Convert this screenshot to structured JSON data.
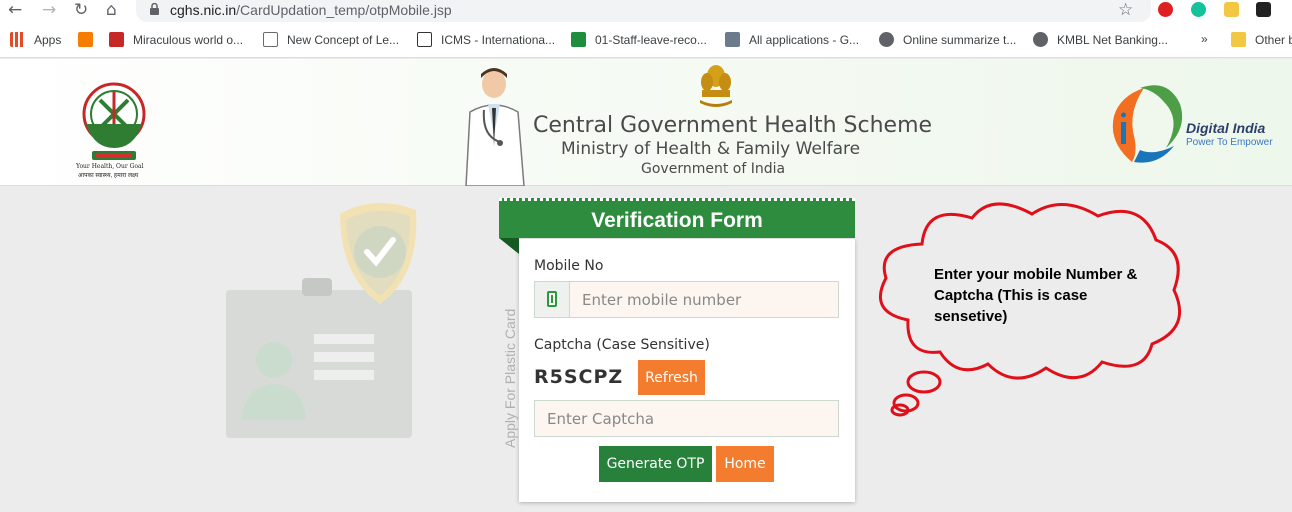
{
  "browser": {
    "url_host": "cghs.nic.in",
    "url_path": "/CardUpdation_temp/otpMobile.jsp",
    "bookmarks": [
      {
        "label": "Apps",
        "icon": "apps-grid-icon",
        "color": "#e34c26"
      },
      {
        "label": "",
        "icon": "blogger-icon",
        "color": "#f57d00"
      },
      {
        "label": "Miraculous world o...",
        "icon": "m-logo-icon",
        "color": "#c62828"
      },
      {
        "label": "New Concept of Le...",
        "icon": "page-icon",
        "color": "#6b6b6b"
      },
      {
        "label": "ICMS - Internationa...",
        "icon": "icms-icon",
        "color": "#333333"
      },
      {
        "label": "01-Staff-leave-reco...",
        "icon": "sheets-plus-icon",
        "color": "#1e8e3e"
      },
      {
        "label": "All applications - G...",
        "icon": "app-icon",
        "color": "#6b7b8c"
      },
      {
        "label": "Online summarize t...",
        "icon": "globe-icon",
        "color": "#5f6368"
      },
      {
        "label": "KMBL Net Banking...",
        "icon": "globe-icon",
        "color": "#5f6368"
      },
      {
        "label": "Other b",
        "icon": "folder-icon",
        "color": "#f2c744"
      }
    ],
    "more_label": "»"
  },
  "header": {
    "logo_caption": "Your Health, Our Goal",
    "logo_caption_hindi": "आपका स्वास्थ्य, हमारा लक्ष्य",
    "title": "Central Government Health Scheme",
    "ministry": "Ministry of Health & Family Welfare",
    "government": "Government of India",
    "digital_india_title": "Digital India",
    "digital_india_tagline": "Power To Empower"
  },
  "form": {
    "title": "Verification Form",
    "side_label": "Apply For Plastic Card",
    "mobile_label": "Mobile No",
    "mobile_placeholder": "Enter mobile number",
    "captcha_label": "Captcha (Case Sensitive)",
    "captcha_value": "R5SCPZ",
    "refresh_label": "Refresh",
    "captcha_placeholder": "Enter Captcha",
    "generate_label": "Generate OTP",
    "home_label": "Home"
  },
  "annotation": {
    "text": "Enter your mobile Number & Captcha (This is case sensetive)"
  },
  "colors": {
    "accent_green": "#2d8c3e",
    "button_orange": "#f47c2f",
    "cloud_red": "#e0101a"
  }
}
